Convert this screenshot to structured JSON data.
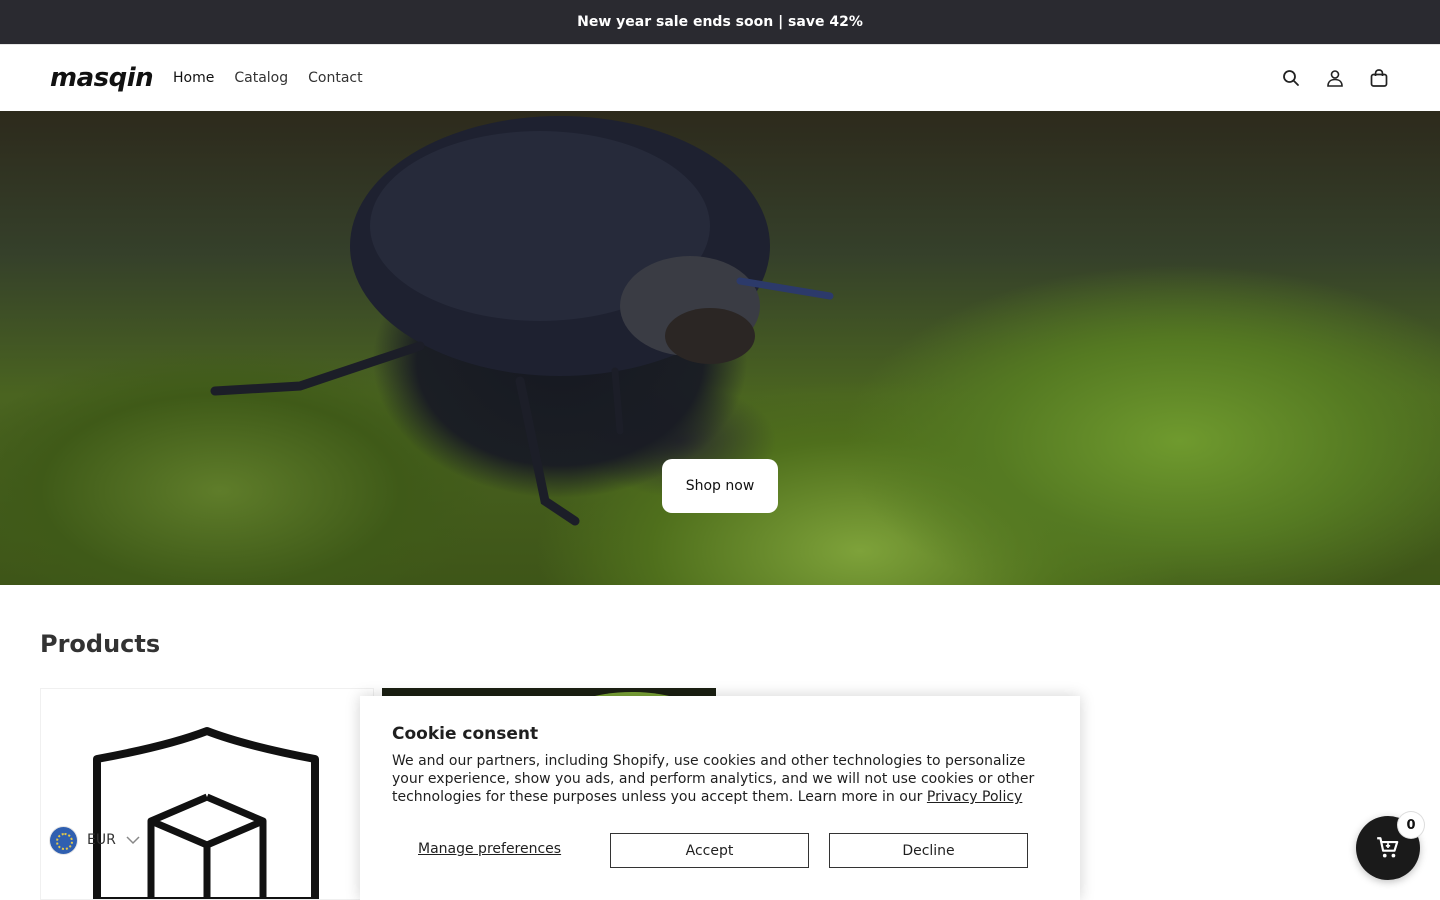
{
  "announcement": {
    "text": "New year sale ends soon | save 42%"
  },
  "header": {
    "logo": "masqin",
    "nav": [
      {
        "label": "Home"
      },
      {
        "label": "Catalog"
      },
      {
        "label": "Contact"
      }
    ],
    "icons": [
      "search-icon",
      "account-icon",
      "cart-icon"
    ]
  },
  "hero": {
    "button_label": "Shop now"
  },
  "products": {
    "title": "Products"
  },
  "currency": {
    "code": "EUR"
  },
  "cookie": {
    "title": "Cookie consent",
    "body": "We and our partners, including Shopify, use cookies and other technologies to personalize your experience, show you ads, and perform analytics, and we will not use cookies or other technologies for these purposes unless you accept them. Learn more in our ",
    "policy_link": "Privacy Policy",
    "manage_label": "Manage preferences",
    "accept_label": "Accept",
    "decline_label": "Decline"
  },
  "floating_cart": {
    "count": "0"
  }
}
